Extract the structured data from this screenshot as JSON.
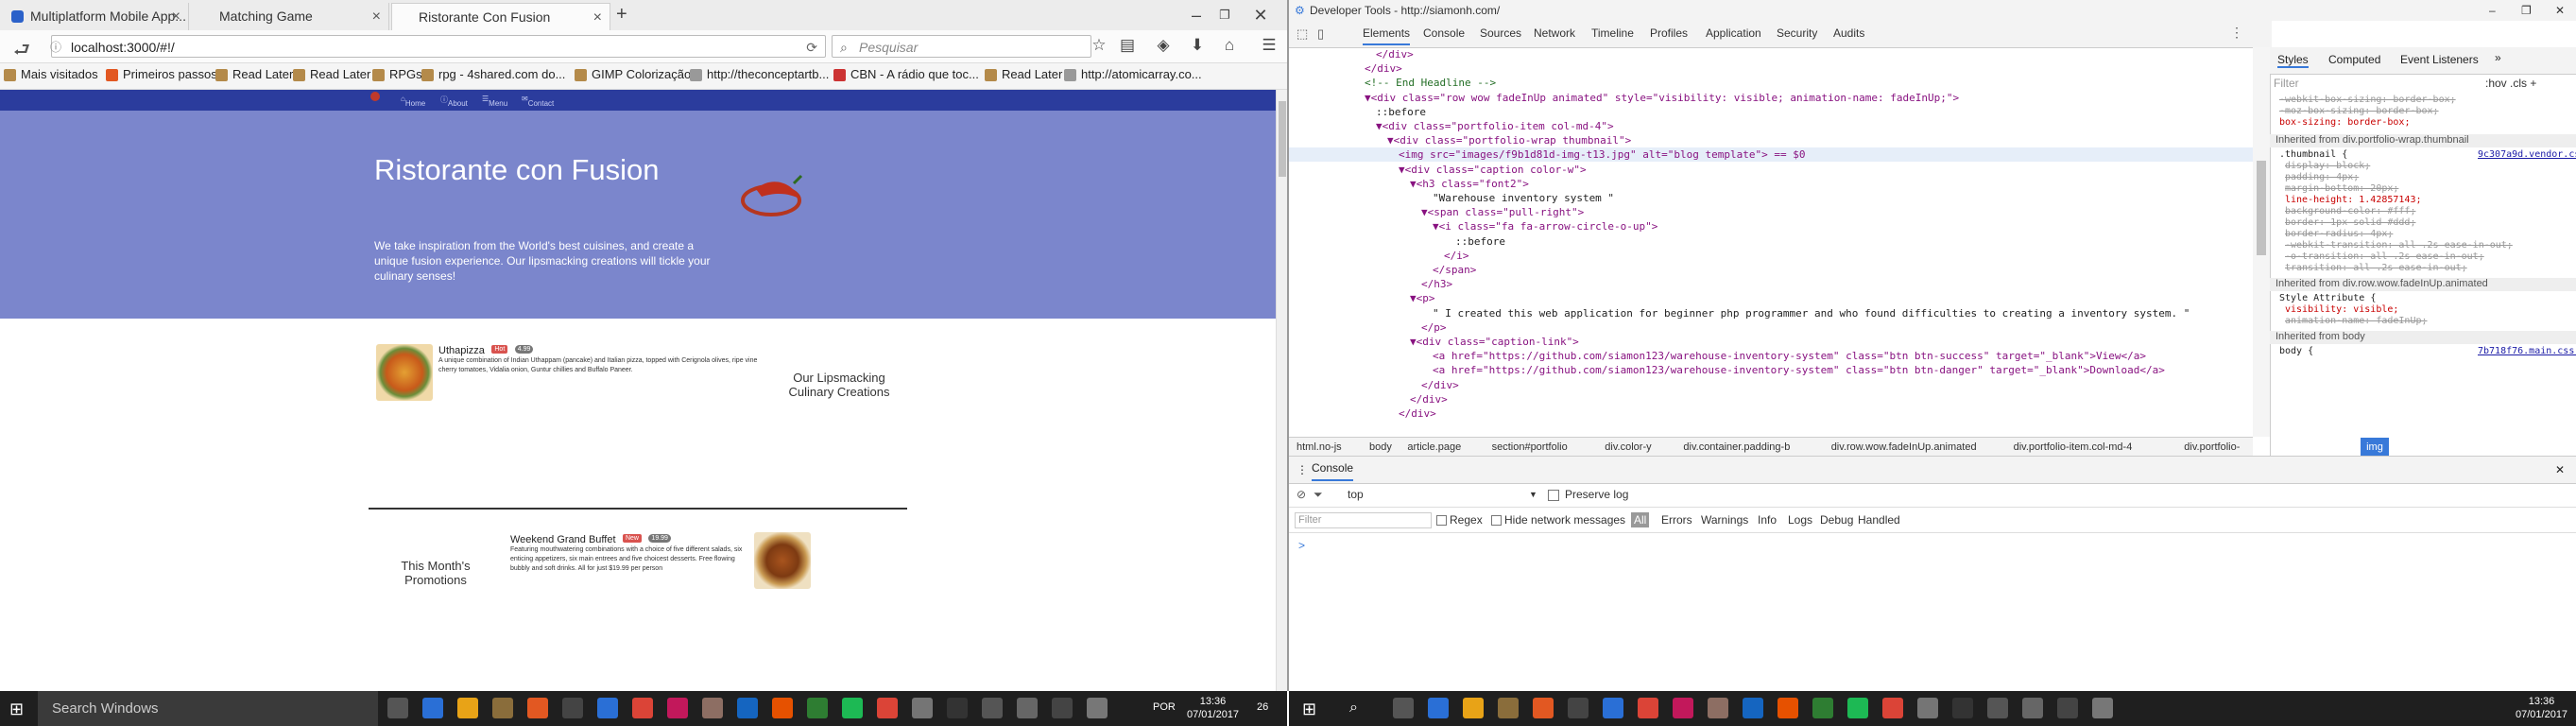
{
  "left_browser": {
    "tabs": [
      {
        "title": "Multiplatform Mobile App..."
      },
      {
        "title": "Matching Game"
      },
      {
        "title": "Ristorante Con Fusion"
      }
    ],
    "url": "localhost:3000/#!/",
    "search_placeholder": "Pesquisar",
    "bookmarks": [
      "Mais visitados",
      "Primeiros passos",
      "Read Later",
      "Read Later",
      "RPGs",
      "rpg - 4shared.com do...",
      "GIMP Colorização",
      "http://theconceptartb...",
      "CBN - A rádio que toc...",
      "Read Later",
      "http://atomicarray.co..."
    ],
    "site_nav": [
      "Home",
      "About",
      "Menu",
      "Contact"
    ],
    "jumbotron": {
      "title": "Ristorante con Fusion",
      "text": "We take inspiration from the World's best cuisines, and create a unique fusion experience. Our lipsmacking creations will tickle your culinary senses!"
    },
    "featured_dish": {
      "name": "Uthapizza",
      "badge1": "Hot",
      "badge2": "4.99",
      "description": "A unique combination of Indian Uthappam (pancake) and Italian pizza, topped with Cerignola olives, ripe vine cherry tomatoes, Vidalia onion, Guntur chillies and Buffalo Paneer."
    },
    "culinary_heading": "Our Lipsmacking Culinary Creations",
    "promotion": {
      "name": "Weekend Grand Buffet",
      "badge1": "New",
      "badge2": "19.99",
      "description": "Featuring mouthwatering combinations with a choice of five different salads, six enticing appetizers, six main entrees and five choicest desserts. Free flowing bubbly and soft drinks. All for just $19.99 per person"
    },
    "promotions_heading": "This Month's Promotions"
  },
  "devtools": {
    "window_title": "Developer Tools - http://siamonh.com/",
    "tabs": [
      "Elements",
      "Console",
      "Sources",
      "Network",
      "Timeline",
      "Profiles",
      "Application",
      "Security",
      "Audits"
    ],
    "code_lines": [
      {
        "indent": 8,
        "html": "</div>"
      },
      {
        "indent": 6,
        "html": "</div>"
      },
      {
        "indent": 6,
        "html": "<!-- End Headline -->"
      },
      {
        "indent": 6,
        "html": "▼<div class=\"row wow fadeInUp animated\" style=\"visibility: visible; animation-name: fadeInUp;\">"
      },
      {
        "indent": 8,
        "html": "::before"
      },
      {
        "indent": 8,
        "html": "▼<div class=\"portfolio-item col-md-4\">"
      },
      {
        "indent": 10,
        "html": "▼<div class=\"portfolio-wrap thumbnail\">"
      },
      {
        "indent": 12,
        "html": "<img src=\"images/f9b1d81d-img-t13.jpg\" alt=\"blog template\"> == $0"
      },
      {
        "indent": 12,
        "html": "▼<div class=\"caption color-w\">"
      },
      {
        "indent": 14,
        "html": "▼<h3 class=\"font2\">"
      },
      {
        "indent": 18,
        "html": "\"Warehouse inventory system \""
      },
      {
        "indent": 16,
        "html": "▼<span class=\"pull-right\">"
      },
      {
        "indent": 18,
        "html": "▼<i class=\"fa fa-arrow-circle-o-up\">"
      },
      {
        "indent": 22,
        "html": "::before"
      },
      {
        "indent": 20,
        "html": "</i>"
      },
      {
        "indent": 18,
        "html": "</span>"
      },
      {
        "indent": 16,
        "html": "</h3>"
      },
      {
        "indent": 14,
        "html": "▼<p>"
      },
      {
        "indent": 18,
        "html": "\" I created this web application for beginner php programmer and who found difficulties to creating a inventory system. \""
      },
      {
        "indent": 16,
        "html": "</p>"
      },
      {
        "indent": 14,
        "html": "▼<div class=\"caption-link\">"
      },
      {
        "indent": 18,
        "html": "<a href=\"https://github.com/siamon123/warehouse-inventory-system\" class=\"btn btn-success\" target=\"_blank\">View</a>"
      },
      {
        "indent": 18,
        "html": "<a href=\"https://github.com/siamon123/warehouse-inventory-system\" class=\"btn btn-danger\" target=\"_blank\">Download</a>"
      },
      {
        "indent": 16,
        "html": "</div>"
      },
      {
        "indent": 14,
        "html": "</div>"
      },
      {
        "indent": 12,
        "html": "</div>"
      }
    ],
    "breadcrumbs": [
      "html.no-js",
      "body",
      "article.page",
      "section#portfolio",
      "div.color-y",
      "div.container.padding-b",
      "div.row.wow.fadeInUp.animated",
      "div.portfolio-item.col-md-4",
      "div.portfolio-wrap.thumbnail",
      "img"
    ],
    "styles_tabs": [
      "Styles",
      "Computed",
      "Event Listeners"
    ],
    "styles_filter": "Filter",
    "styles_hov": ":hov .cls +",
    "styles_lines": [
      {
        "t": "-webkit-box-sizing: border-box;",
        "s": true
      },
      {
        "t": "-moz-box-sizing: border-box;",
        "s": true
      },
      {
        "t": "box-sizing: border-box;",
        "s": false
      }
    ],
    "inherited_1": "Inherited from div.portfolio-wrap.thumbnail",
    "thumbnail_rule": ".thumbnail {",
    "thumbnail_src": "9c307a9d.vendor.css:5",
    "thumbnail_props": [
      {
        "t": "display: block;",
        "s": true
      },
      {
        "t": "padding: 4px;",
        "s": true
      },
      {
        "t": "margin-bottom: 20px;",
        "s": true
      },
      {
        "t": "line-height: 1.42857143;",
        "s": false
      },
      {
        "t": "background-color: #fff;",
        "s": true
      },
      {
        "t": "border: 1px solid #ddd;",
        "s": true
      },
      {
        "t": "border-radius: 4px;",
        "s": true
      },
      {
        "t": "-webkit-transition: all .2s ease-in-out;",
        "s": true
      },
      {
        "t": "-o-transition: all .2s ease-in-out;",
        "s": true
      },
      {
        "t": "transition: all .2s ease-in-out;",
        "s": true
      }
    ],
    "inherited_2": "Inherited from div.row.wow.fadeInUp.animated",
    "style_attr": "Style Attribute {",
    "style_attr_props": [
      {
        "t": "visibility: visible;",
        "s": false
      },
      {
        "t": "animation-name: fadeInUp;",
        "s": true
      }
    ],
    "inherited_3": "Inherited from body",
    "body_rule": "body {",
    "body_src": "7b718f76.main.css:1",
    "console_label": "Console",
    "console_context": "top",
    "preserve_log": "Preserve log",
    "console_filter": "Filter",
    "regex": "Regex",
    "hide_network": "Hide network messages",
    "levels": [
      "All",
      "Errors",
      "Warnings",
      "Info",
      "Logs",
      "Debug",
      "Handled"
    ],
    "prompt": ">"
  },
  "taskbar": {
    "search_placeholder": "Search Windows",
    "lang": "POR",
    "time": "13:36",
    "date": "07/01/2017",
    "notif_count": "26"
  }
}
